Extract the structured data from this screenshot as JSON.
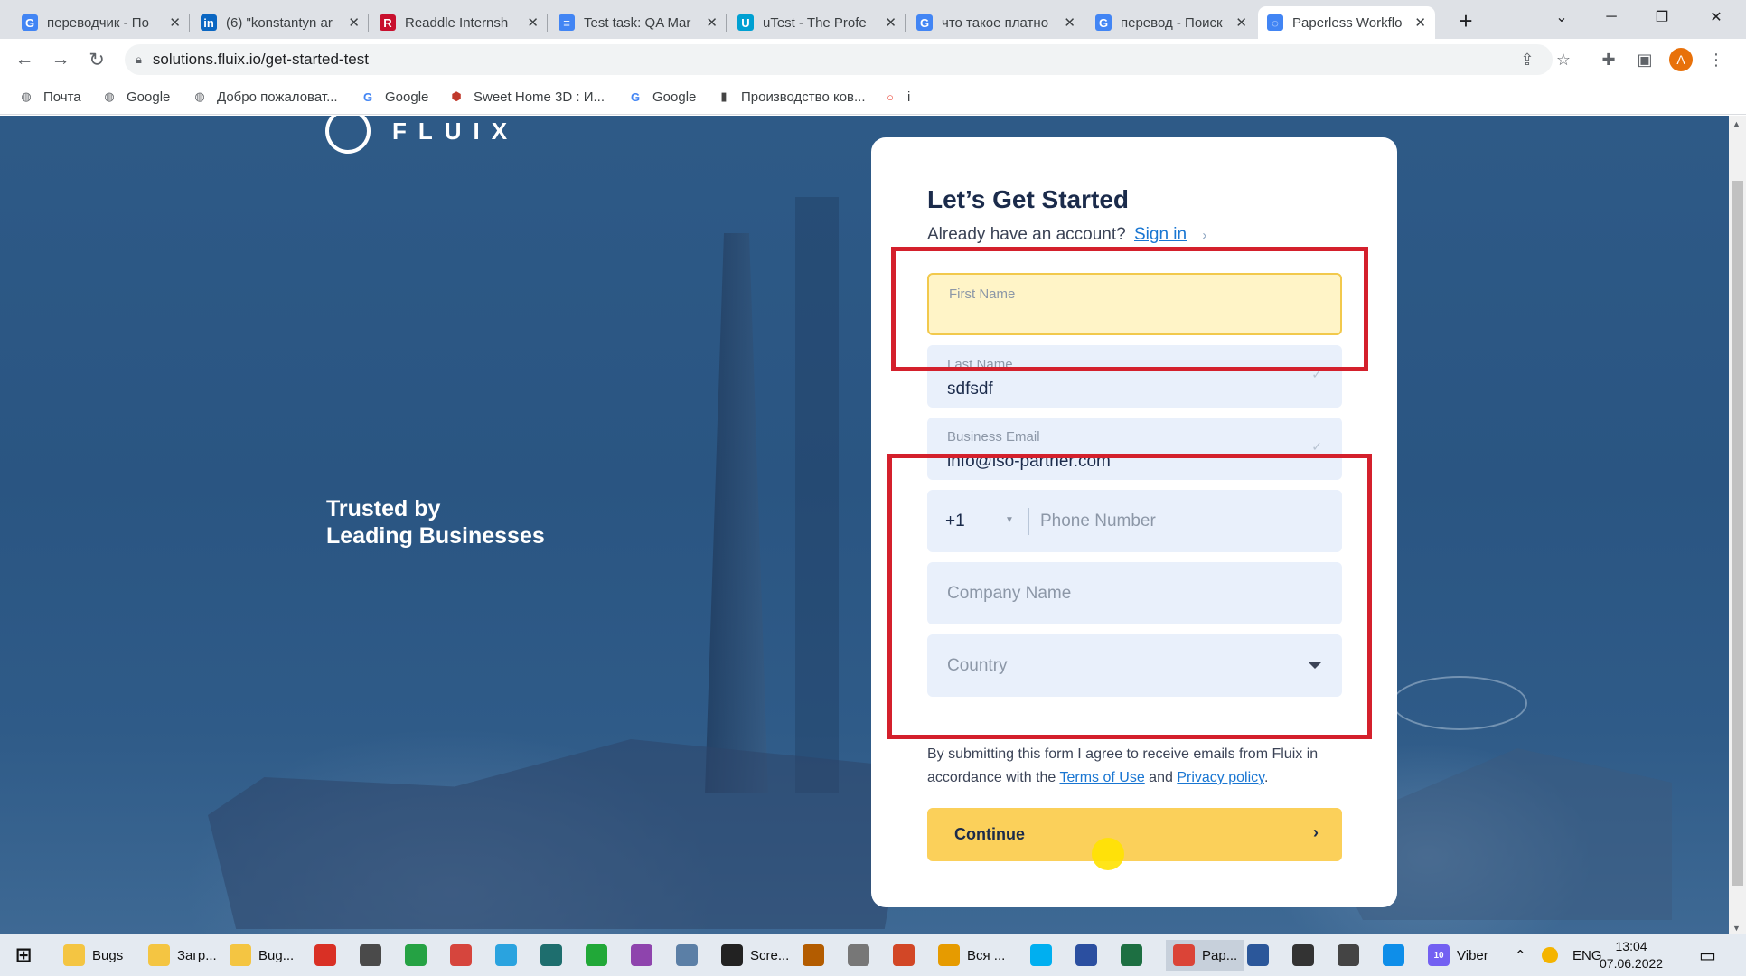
{
  "tabs": [
    {
      "title": "переводчик - По",
      "icon": "google-icon",
      "color": "#4285f4"
    },
    {
      "title": "(6) \"konstantyn ar",
      "icon": "linkedin-icon",
      "color": "#0a66c2"
    },
    {
      "title": "Readdle Internsh",
      "icon": "readdle-icon",
      "color": "#c8102e"
    },
    {
      "title": "Test task: QA Mar",
      "icon": "google-docs-icon",
      "color": "#4285f4"
    },
    {
      "title": "uTest - The Profe",
      "icon": "utest-icon",
      "color": "#00a0d2"
    },
    {
      "title": "что такое платно",
      "icon": "google-icon",
      "color": "#4285f4"
    },
    {
      "title": "перевод - Поиск",
      "icon": "google-icon",
      "color": "#4285f4"
    },
    {
      "title": "Paperless Workflo",
      "icon": "loading-icon",
      "color": "#4285f4",
      "active": true
    }
  ],
  "toolbar": {
    "url": "solutions.fluix.io/get-started-test",
    "profile_initial": "A"
  },
  "bookmarks": [
    {
      "label": "Почта",
      "icon": "globe-icon"
    },
    {
      "label": "Google",
      "icon": "globe-icon"
    },
    {
      "label": "Добро пожаловат...",
      "icon": "globe-icon"
    },
    {
      "label": "Google",
      "icon": "google-icon"
    },
    {
      "label": "Sweet Home 3D : И...",
      "icon": "sweet-home-icon"
    },
    {
      "label": "Google",
      "icon": "google-icon"
    },
    {
      "label": "Производство ков...",
      "icon": "factory-icon"
    },
    {
      "label": "i",
      "icon": "chrome-ring-icon"
    }
  ],
  "page": {
    "logo_text": "FLUIX",
    "trusted_line1": "Trusted by",
    "trusted_line2": "Leading Businesses"
  },
  "form": {
    "title": "Let’s Get Started",
    "have_account": "Already have an account?",
    "sign_in": "Sign in",
    "first_name_label": "First Name",
    "first_name_value": "",
    "last_name_label": "Last Name",
    "last_name_value": "sdfsdf",
    "email_label": "Business Email",
    "email_value": "info@iso-partner.com",
    "phone_code": "+1",
    "phone_placeholder": "Phone Number",
    "company_placeholder": "Company Name",
    "country_placeholder": "Country",
    "consent_text": "By submitting this form I agree to receive emails from Fluix in accordance with the",
    "terms_link": "Terms of Use",
    "and_text": "and",
    "privacy_link": "Privacy policy",
    "continue_label": "Continue"
  },
  "taskbar": {
    "items": [
      {
        "label": "Bugs",
        "icon": "folder-icon",
        "color": "#f4c542"
      },
      {
        "label": "Загр...",
        "icon": "folder-icon",
        "color": "#f4c542"
      },
      {
        "label": "Bug...",
        "icon": "folder-icon",
        "color": "#f4c542"
      },
      {
        "label": "",
        "icon": "pdf-icon",
        "color": "#d93025"
      },
      {
        "label": "",
        "icon": "settings-icon",
        "color": "#4a4a4a"
      },
      {
        "label": "",
        "icon": "app-icon",
        "color": "#25a244"
      },
      {
        "label": "",
        "icon": "app-icon",
        "color": "#d6453d"
      },
      {
        "label": "",
        "icon": "telegram-icon",
        "color": "#2aa3df"
      },
      {
        "label": "",
        "icon": "app-icon",
        "color": "#1e6e6e"
      },
      {
        "label": "",
        "icon": "app-icon",
        "color": "#21a838"
      },
      {
        "label": "",
        "icon": "app-icon",
        "color": "#8e44ad"
      },
      {
        "label": "",
        "icon": "app-icon",
        "color": "#5b7fa6"
      },
      {
        "label": "Scre...",
        "icon": "record-icon",
        "color": "#222222"
      },
      {
        "label": "",
        "icon": "app-icon",
        "color": "#b35c00"
      },
      {
        "label": "",
        "icon": "app-icon",
        "color": "#777777"
      },
      {
        "label": "",
        "icon": "powerpoint-icon",
        "color": "#d24726"
      },
      {
        "label": "Вся ...",
        "icon": "app-icon",
        "color": "#e69b00"
      },
      {
        "label": "",
        "icon": "skype-icon",
        "color": "#00aff0"
      },
      {
        "label": "",
        "icon": "app-icon",
        "color": "#2b4fa0"
      },
      {
        "label": "",
        "icon": "excel-icon",
        "color": "#1d6f42"
      },
      {
        "label": "Pap...",
        "icon": "chrome-icon",
        "color": "#db4437",
        "active": true
      },
      {
        "label": "",
        "icon": "word-icon",
        "color": "#2b579a"
      },
      {
        "label": "",
        "icon": "camera-icon",
        "color": "#333333"
      },
      {
        "label": "",
        "icon": "calculator-icon",
        "color": "#444444"
      },
      {
        "label": "",
        "icon": "teamviewer-icon",
        "color": "#0e8ee9"
      },
      {
        "label": "Viber",
        "icon": "viber-icon",
        "color": "#7360f2",
        "badge": "10"
      }
    ],
    "lang": "ENG",
    "time": "13:04",
    "date": "07.06.2022"
  },
  "colors": {
    "accent_yellow": "#fbd05a",
    "annotation_red": "#d4202c",
    "field_bg": "#e9f0fb",
    "link_blue": "#1976d2"
  }
}
